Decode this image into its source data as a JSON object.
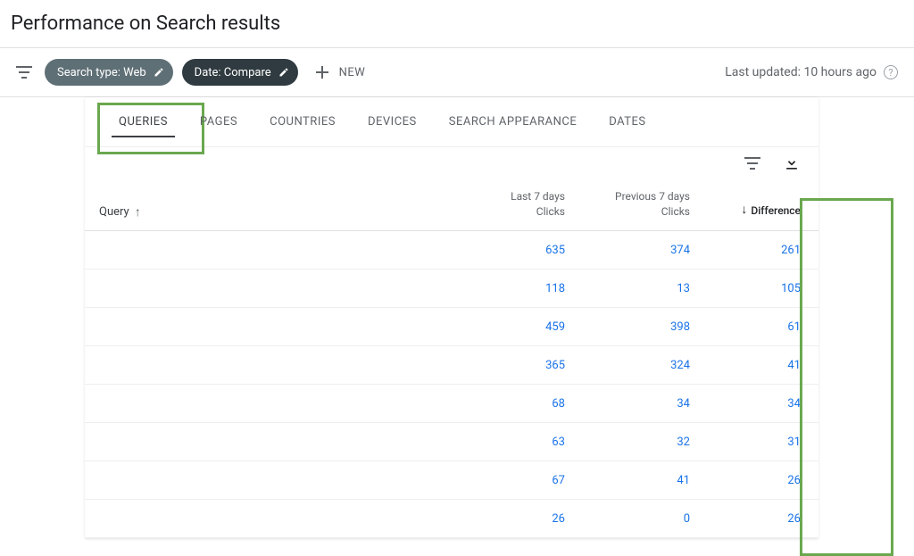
{
  "header": {
    "title": "Performance on Search results"
  },
  "filters": {
    "chip_search_type": "Search type: Web",
    "chip_date": "Date: Compare",
    "new_label": "NEW",
    "last_updated": "Last updated: 10 hours ago",
    "help_glyph": "?"
  },
  "tabs": {
    "queries": "QUERIES",
    "pages": "PAGES",
    "countries": "COUNTRIES",
    "devices": "DEVICES",
    "search_appearance": "SEARCH APPEARANCE",
    "dates": "DATES"
  },
  "table": {
    "query_col": "Query",
    "sort_query_glyph": "↑",
    "head_last7_l1": "Last 7 days",
    "head_last7_l2": "Clicks",
    "head_prev7_l1": "Previous 7 days",
    "head_prev7_l2": "Clicks",
    "sort_diff_glyph": "↓",
    "head_diff": "Difference",
    "rows": [
      {
        "last7": "635",
        "prev7": "374",
        "diff": "261"
      },
      {
        "last7": "118",
        "prev7": "13",
        "diff": "105"
      },
      {
        "last7": "459",
        "prev7": "398",
        "diff": "61"
      },
      {
        "last7": "365",
        "prev7": "324",
        "diff": "41"
      },
      {
        "last7": "68",
        "prev7": "34",
        "diff": "34"
      },
      {
        "last7": "63",
        "prev7": "32",
        "diff": "31"
      },
      {
        "last7": "67",
        "prev7": "41",
        "diff": "26"
      },
      {
        "last7": "26",
        "prev7": "0",
        "diff": "26"
      }
    ]
  }
}
